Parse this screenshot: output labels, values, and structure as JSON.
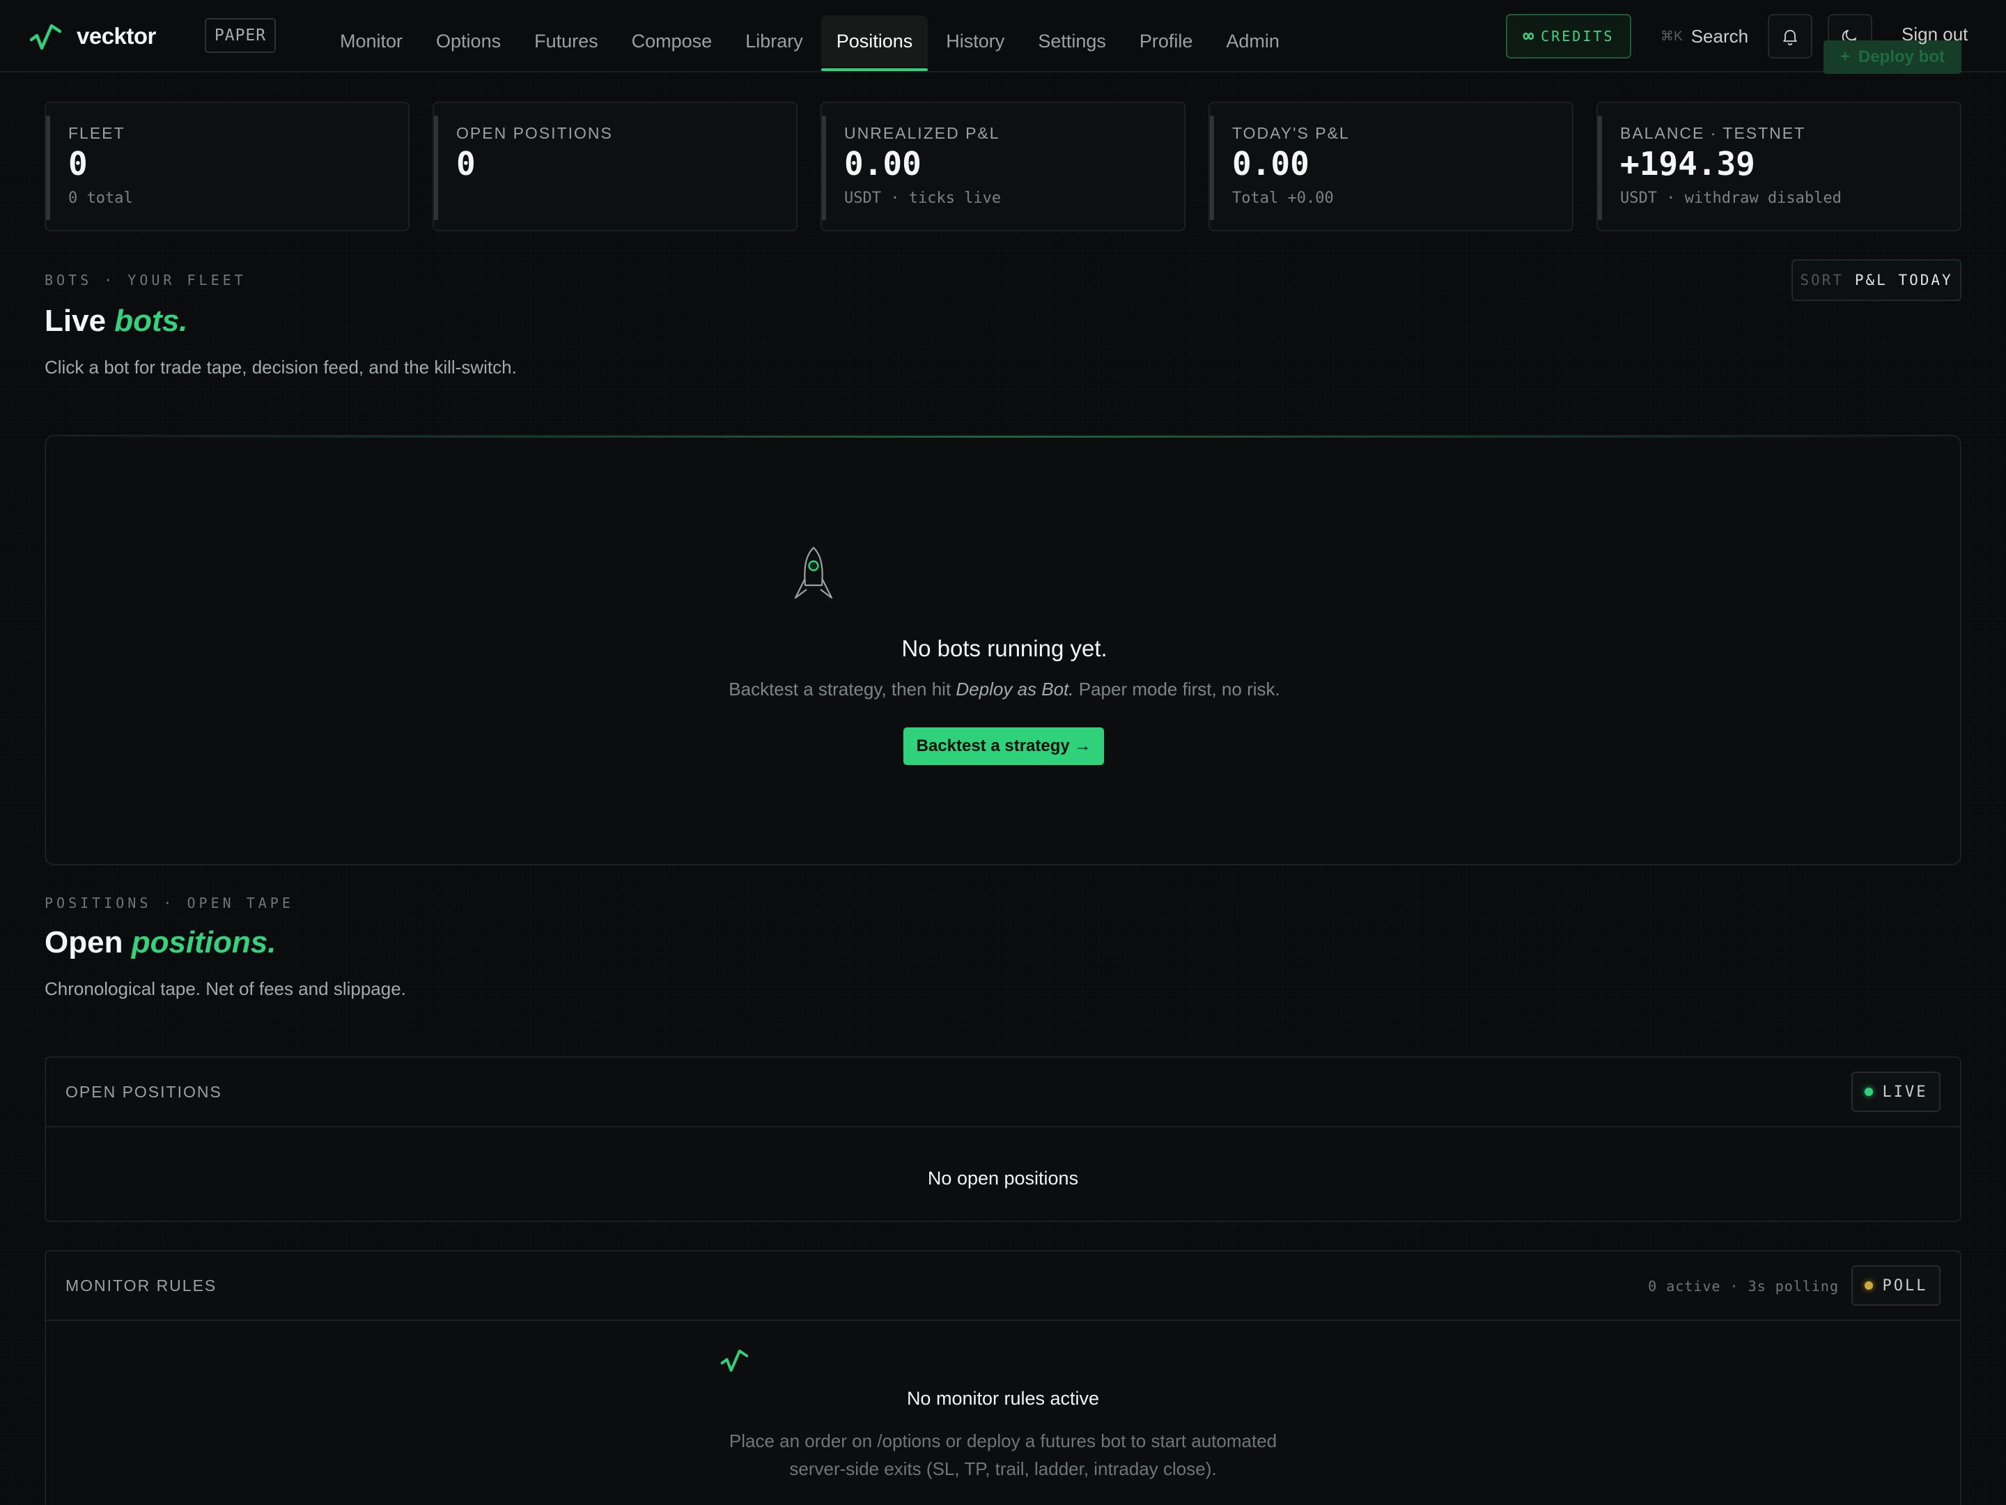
{
  "brand": {
    "name": "vecktor",
    "mode_badge": "PAPER"
  },
  "nav": {
    "items": [
      "Monitor",
      "Options",
      "Futures",
      "Compose",
      "Library",
      "Positions",
      "History",
      "Settings",
      "Profile",
      "Admin"
    ],
    "active": "Positions"
  },
  "header": {
    "credits_symbol": "∞",
    "credits_label": "CREDITS",
    "search_shortcut": "⌘K",
    "search_label": "Search",
    "signout_label": "Sign out",
    "deploy_label": "Deploy bot",
    "deploy_plus": "+"
  },
  "stats": [
    {
      "label": "FLEET",
      "value": "0",
      "sub": "0 total"
    },
    {
      "label": "OPEN POSITIONS",
      "value": "0",
      "sub": ""
    },
    {
      "label": "UNREALIZED P&L",
      "value": "0.00",
      "sub": "USDT · ticks live"
    },
    {
      "label": "TODAY'S P&L",
      "value": "0.00",
      "sub": "Total +0.00"
    },
    {
      "label": "BALANCE · TESTNET",
      "value": "+194.39",
      "sub": "USDT · withdraw disabled"
    }
  ],
  "bots_section": {
    "eyebrow": "BOTS · YOUR FLEET",
    "title_plain": "Live",
    "title_accent": "bots.",
    "description": "Click a bot for trade tape, decision feed, and the kill-switch.",
    "sort_key": "SORT",
    "sort_value": "P&L TODAY",
    "empty_title": "No bots running yet.",
    "empty_desc_before": "Backtest a strategy, then hit",
    "empty_desc_em": "Deploy as Bot.",
    "empty_desc_after": "Paper mode first, no risk.",
    "cta_label": "Backtest a strategy →"
  },
  "positions_section": {
    "eyebrow": "POSITIONS · OPEN TAPE",
    "title_plain": "Open",
    "title_accent": "positions.",
    "description": "Chronological tape. Net of fees and slippage."
  },
  "open_positions_panel": {
    "title": "OPEN POSITIONS",
    "status": "LIVE",
    "empty": "No open positions"
  },
  "monitor_panel": {
    "title": "MONITOR RULES",
    "meta": "0 active · 3s polling",
    "status": "POLL",
    "empty_title": "No monitor rules active",
    "empty_desc_line1": "Place an order on /options or deploy a futures bot to start automated",
    "empty_desc_line2": "server-side exits (SL, TP, trail, ladder, intraday close)."
  },
  "colors": {
    "accent": "#2fd27a",
    "background": "#090b0c",
    "poll_dot": "#cfa93a"
  },
  "icons": [
    "vecktor-logo-icon",
    "bell-icon",
    "moon-icon",
    "rocket-icon"
  ]
}
